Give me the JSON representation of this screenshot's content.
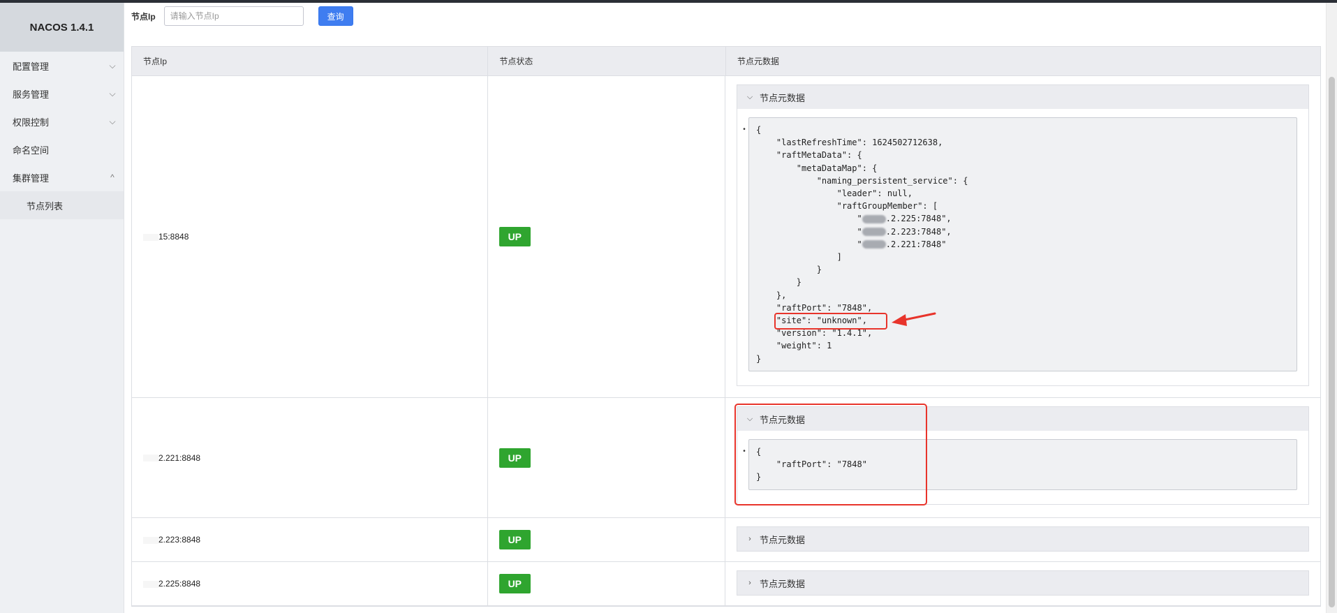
{
  "app": {
    "brand": "NACOS 1.4.1"
  },
  "sidebar": {
    "items": [
      {
        "label": "配置管理",
        "chevron": "down"
      },
      {
        "label": "服务管理",
        "chevron": "down"
      },
      {
        "label": "权限控制",
        "chevron": "down"
      },
      {
        "label": "命名空间",
        "chevron": ""
      },
      {
        "label": "集群管理",
        "chevron": "up"
      }
    ],
    "subitems": [
      {
        "label": "节点列表"
      }
    ]
  },
  "search": {
    "label": "节点Ip",
    "placeholder": "请输入节点Ip",
    "button": "查询"
  },
  "table": {
    "headers": {
      "ip": "节点Ip",
      "state": "节点状态",
      "meta": "节点元数据"
    },
    "rows": [
      {
        "ip": "15:8848",
        "state": "UP",
        "meta_title": "节点元数据",
        "expanded": true
      },
      {
        "ip": "2.221:8848",
        "state": "UP",
        "meta_title": "节点元数据",
        "expanded": true
      },
      {
        "ip": "2.223:8848",
        "state": "UP",
        "meta_title": "节点元数据",
        "expanded": false
      },
      {
        "ip": "2.225:8848",
        "state": "UP",
        "meta_title": "节点元数据",
        "expanded": false
      }
    ]
  },
  "metadata": {
    "row1_lines": [
      "{",
      "    \"lastRefreshTime\": 1624502712638,",
      "    \"raftMetaData\": {",
      "        \"metaDataMap\": {",
      "            \"naming_persistent_service\": {",
      "                \"leader\": null,",
      "                \"raftGroupMember\": [",
      "                    \"",
      ".2.225:7848\",",
      "                    \"",
      ".2.223:7848\",",
      "                    \"",
      ".2.221:7848\"",
      "                ]",
      "            }",
      "        }",
      "    },",
      "    \"raftPort\": \"7848\",",
      "    \"site\": \"unknown\",",
      "    \"version\": \"1.4.1\",",
      "    \"weight\": 1",
      "}"
    ],
    "row2_lines": [
      "{",
      "    \"raftPort\": \"7848\"",
      "}"
    ]
  },
  "colors": {
    "accent": "#3f7df0",
    "status_up": "#2fa52f",
    "annotation": "#e8342b"
  }
}
